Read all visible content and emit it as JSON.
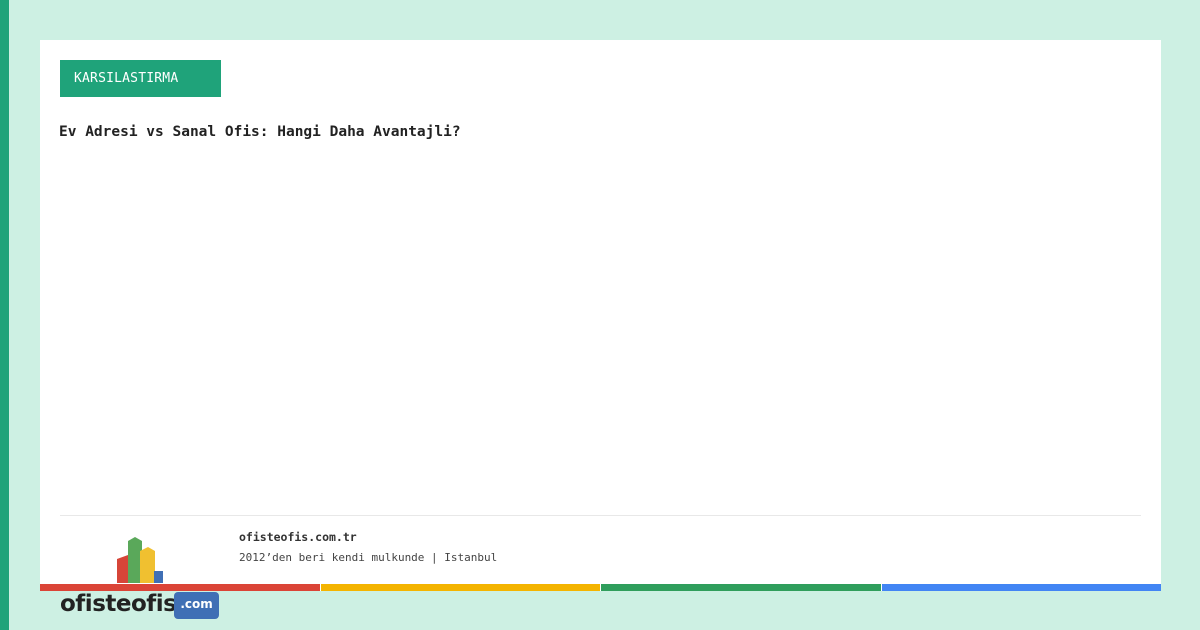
{
  "colors": {
    "accent": "#1fa37a",
    "background": "#cdf0e3",
    "card": "#ffffff",
    "stripes": [
      "#db4437",
      "#f4b400",
      "#2f9e5c",
      "#4285f4"
    ],
    "logo_blocks": [
      "#d64538",
      "#5aa85a",
      "#f0c030",
      "#3f6fb5"
    ]
  },
  "card": {
    "category": "KARSILASTIRMA",
    "title": "Ev Adresi vs Sanal Ofis: Hangi Daha Avantajli?"
  },
  "footer": {
    "site": "ofisteofis.com.tr",
    "tagline": "2012’den beri kendi mulkunde | Istanbul"
  },
  "brand": {
    "wordmark": "ofisteofis",
    "tld": ".com",
    "logo_icon": "building-blocks-icon"
  }
}
